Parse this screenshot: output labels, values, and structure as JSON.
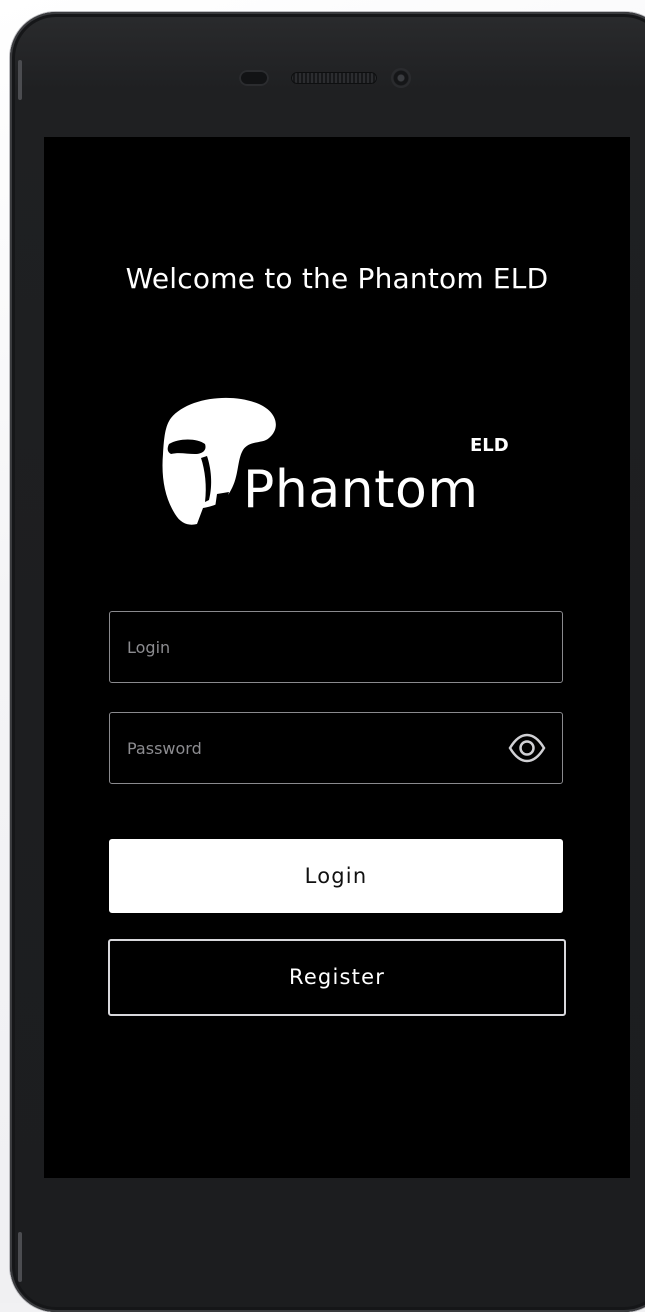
{
  "app": {
    "welcome_text": "Welcome to the Phantom ELD",
    "brand": {
      "name": "Phantom",
      "suffix": "ELD"
    }
  },
  "form": {
    "login_placeholder": "Login",
    "password_placeholder": "Password",
    "password_toggle_icon": "eye-icon"
  },
  "actions": {
    "login_label": "Login",
    "register_label": "Register"
  },
  "colors": {
    "screen_background": "#000000",
    "primary_button": "#ffffff",
    "text": "#ffffff"
  }
}
